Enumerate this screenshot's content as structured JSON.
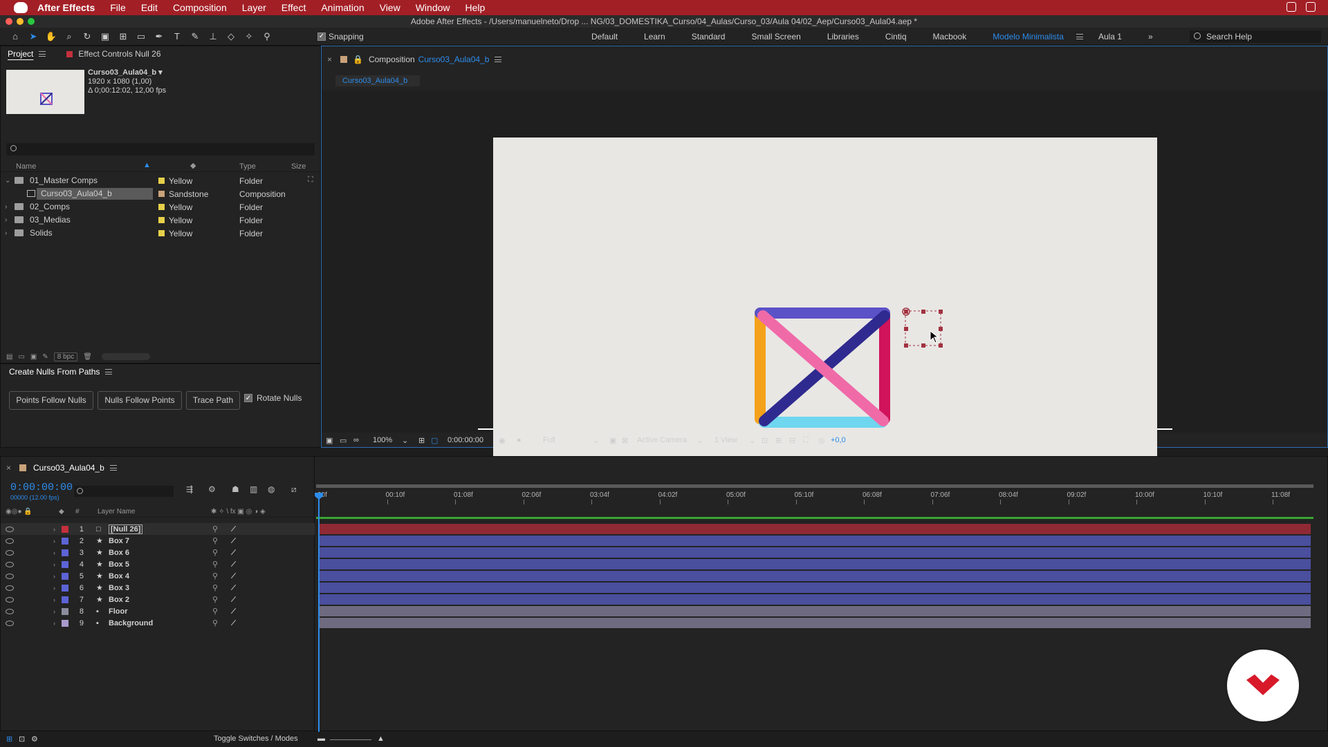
{
  "menubar": {
    "app": "After Effects",
    "items": [
      "File",
      "Edit",
      "Composition",
      "Layer",
      "Effect",
      "Animation",
      "View",
      "Window",
      "Help"
    ]
  },
  "window": {
    "title": "Adobe After Effects - /Users/manuelneto/Drop ... NG/03_DOMESTIKA_Curso/04_Aulas/Curso_03/Aula 04/02_Aep/Curso03_Aula04.aep *"
  },
  "toolbar": {
    "snapping_label": "Snapping",
    "workspaces": [
      "Default",
      "Learn",
      "Standard",
      "Small Screen",
      "Libraries",
      "Cintiq",
      "Macbook",
      "Modelo Minimalista",
      "Aula 1"
    ],
    "active_workspace": "Modelo Minimalista",
    "search_placeholder": "Search Help"
  },
  "project_panel": {
    "tabs": [
      "Project",
      "Effect Controls Null 26"
    ],
    "thumb_name": "Curso03_Aula04_b ▾",
    "thumb_info_1": "1920 x 1080 (1,00)",
    "thumb_info_2": "Δ 0;00:12:02, 12,00 fps",
    "columns": {
      "name": "Name",
      "type": "Type",
      "size": "Size"
    },
    "rows": [
      {
        "name": "01_Master Comps",
        "label": "Yellow",
        "type": "Folder",
        "color": "#e6d04a"
      },
      {
        "name": "Curso03_Aula04_b",
        "label": "Sandstone",
        "type": "Composition",
        "color": "#c9a27a"
      },
      {
        "name": "02_Comps",
        "label": "Yellow",
        "type": "Folder",
        "color": "#e6d04a"
      },
      {
        "name": "03_Medias",
        "label": "Yellow",
        "type": "Folder",
        "color": "#e6d04a"
      },
      {
        "name": "Solids",
        "label": "Yellow",
        "type": "Folder",
        "color": "#e6d04a"
      }
    ],
    "bpc": "8 bpc"
  },
  "nulls_panel": {
    "title": "Create Nulls From Paths",
    "buttons": [
      "Points Follow Nulls",
      "Nulls Follow Points",
      "Trace Path"
    ],
    "checkbox": "Rotate Nulls"
  },
  "composition": {
    "tab_prefix": "Composition",
    "tab_name": "Curso03_Aula04_b",
    "sub_tab": "Curso03_Aula04_b",
    "zoom": "100%",
    "time": "0:00:00:00",
    "resolution": "Full",
    "camera": "Active Camera",
    "views": "1 View",
    "exposure": "+0,0",
    "art_colors": {
      "top": "#5b52c8",
      "diagonal_dark": "#2f2a8f",
      "diagonal_pink": "#f06aa8",
      "left": "#f4a21a",
      "right": "#d0135a",
      "bottom": "#6fd6ef",
      "null": "#a23240"
    }
  },
  "timeline": {
    "comp_tab": "Curso03_Aula04_b",
    "timecode": "0:00:00:00",
    "timecode_sub": "00000 (12.00 fps)",
    "layer_name_header": "Layer Name",
    "ruler_labels": [
      "00f",
      "00:10f",
      "01:08f",
      "02:06f",
      "03:04f",
      "04:02f",
      "05:00f",
      "05:10f",
      "06:08f",
      "07:06f",
      "08:04f",
      "09:02f",
      "10:00f",
      "10:10f",
      "11:08f"
    ],
    "layers": [
      {
        "num": "1",
        "name": "[Null 26]",
        "color": "#c4303c",
        "bar": "#8f2a35",
        "icon": "□"
      },
      {
        "num": "2",
        "name": "Box 7",
        "color": "#5c63d6",
        "bar": "#4a4f9e",
        "icon": "★"
      },
      {
        "num": "3",
        "name": "Box 6",
        "color": "#5c63d6",
        "bar": "#4a4f9e",
        "icon": "★"
      },
      {
        "num": "4",
        "name": "Box 5",
        "color": "#5c63d6",
        "bar": "#4a4f9e",
        "icon": "★"
      },
      {
        "num": "5",
        "name": "Box 4",
        "color": "#5c63d6",
        "bar": "#4a4f9e",
        "icon": "★"
      },
      {
        "num": "6",
        "name": "Box 3",
        "color": "#5c63d6",
        "bar": "#4a4f9e",
        "icon": "★"
      },
      {
        "num": "7",
        "name": "Box 2",
        "color": "#5c63d6",
        "bar": "#4a4f9e",
        "icon": "★"
      },
      {
        "num": "8",
        "name": "Floor",
        "color": "#8c8c9e",
        "bar": "#6e6b80",
        "icon": "▪"
      },
      {
        "num": "9",
        "name": "Background",
        "color": "#a89acc",
        "bar": "#6e6b80",
        "icon": "▪"
      }
    ],
    "toggle_label": "Toggle Switches / Modes"
  }
}
